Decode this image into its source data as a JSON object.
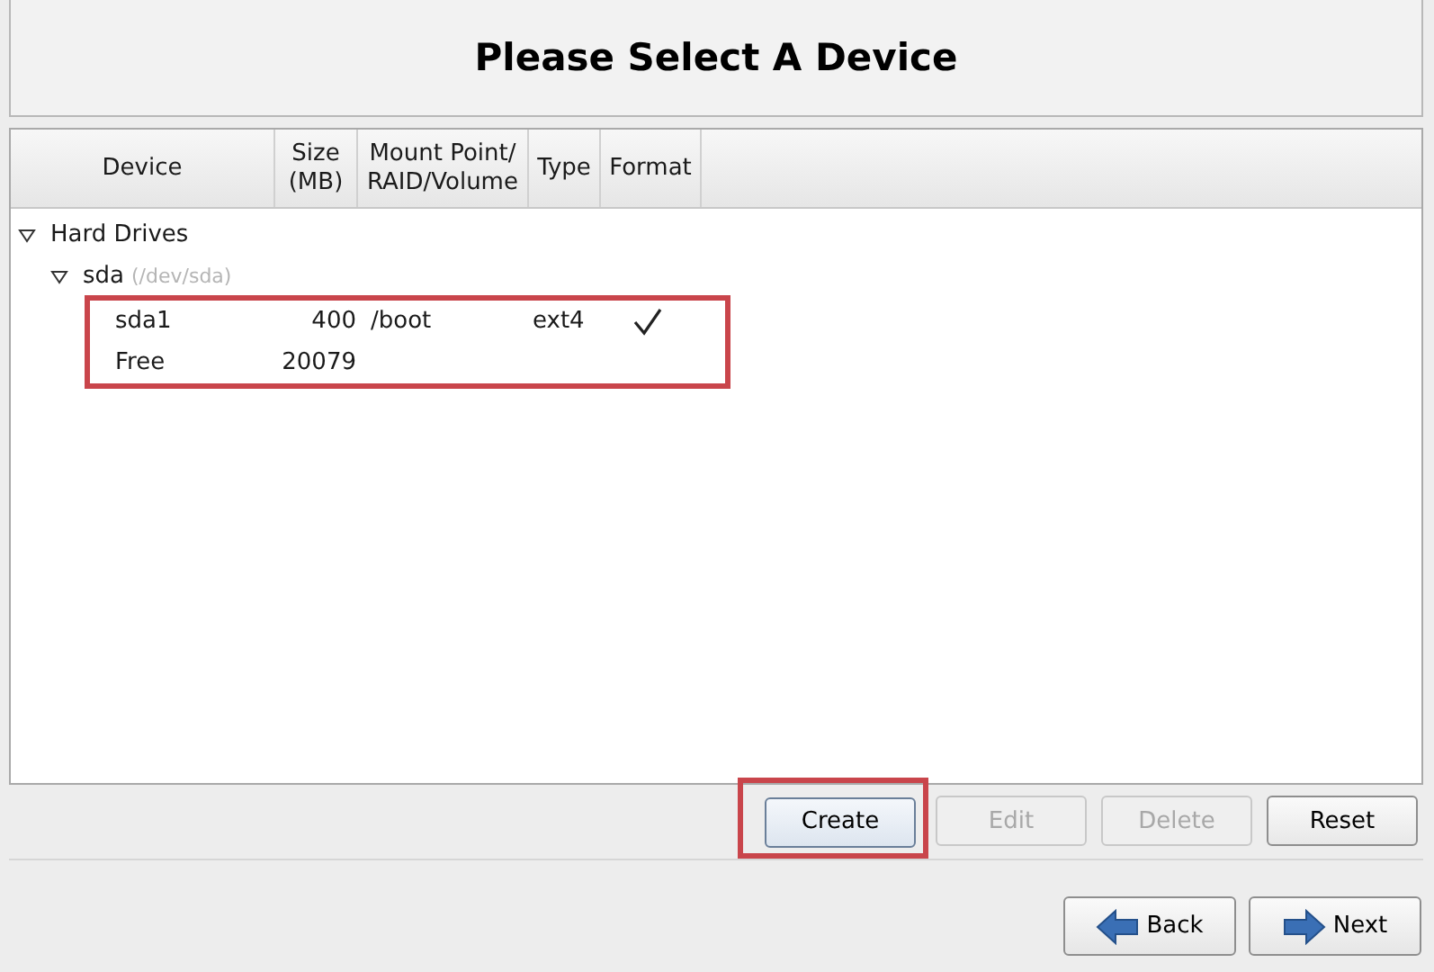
{
  "title": "Please Select A Device",
  "columns": [
    "Device",
    "Size\n(MB)",
    "Mount Point/\nRAID/Volume",
    "Type",
    "Format"
  ],
  "tree": [
    {
      "label": "Hard Drives",
      "expanded": true,
      "children": [
        {
          "label": "sda",
          "path": "(/dev/sda)",
          "expanded": true,
          "highlighted": true,
          "partitions": [
            {
              "device": "sda1",
              "size": "400",
              "mount": "/boot",
              "type": "ext4",
              "format": true
            },
            {
              "device": "Free",
              "size": "20079",
              "format": false
            }
          ]
        }
      ]
    }
  ],
  "buttons": [
    {
      "label": "Create",
      "disabled": false,
      "highlighted": true
    },
    {
      "label": "Edit",
      "disabled": true,
      "highlighted": false
    },
    {
      "label": "Delete",
      "disabled": true,
      "highlighted": false
    },
    {
      "label": "Reset",
      "disabled": false,
      "highlighted": false
    }
  ],
  "nav": [
    {
      "label": "Back",
      "kind": "back"
    },
    {
      "label": "Next",
      "kind": "next"
    }
  ]
}
